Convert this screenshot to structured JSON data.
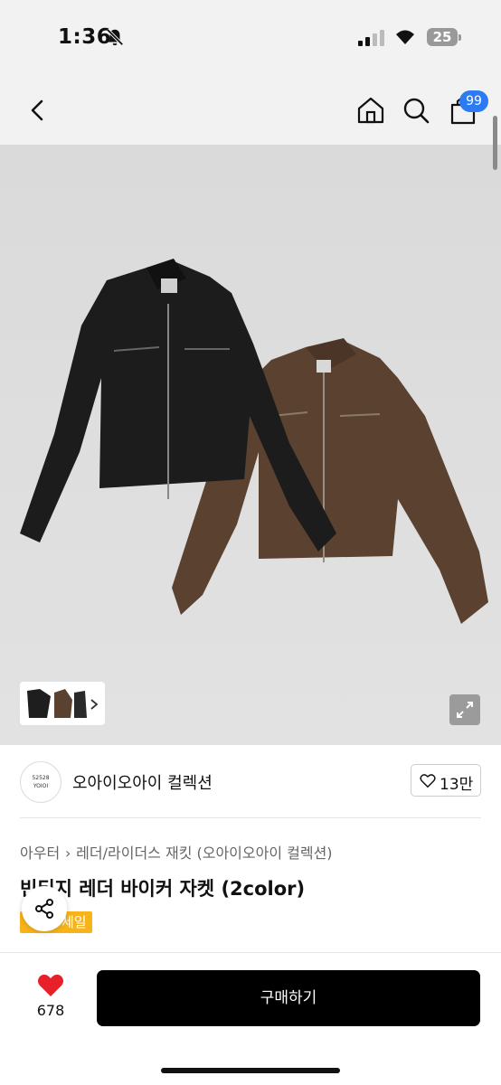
{
  "status_bar": {
    "time": "1:36",
    "battery": "25"
  },
  "nav": {
    "cart_count": "99"
  },
  "hero": {
    "thumbnail_caption": "",
    "jackets": [
      "black-leather-jacket",
      "brown-leather-jacket"
    ],
    "colors": {
      "background": "#dcdcdc",
      "black_jacket": "#1c1c1c",
      "brown_jacket": "#5a4130"
    }
  },
  "store": {
    "logo_line1": "52528",
    "logo_line2": "YOIOI",
    "name": "오아이오아이 컬렉션",
    "likes": "13만"
  },
  "product": {
    "breadcrumb": [
      "아우터",
      "레더/라이더스 재킷 (오아이오아이 컬렉션)"
    ],
    "breadcrumb_sep": "›",
    "title": "빈티지 레더 바이커 자켓 (2color)",
    "badge": "세일",
    "badge_color": "#f7b31a"
  },
  "bottom_bar": {
    "wish_count": "678",
    "buy_label": "구매하기",
    "heart_color": "#e8202a"
  }
}
